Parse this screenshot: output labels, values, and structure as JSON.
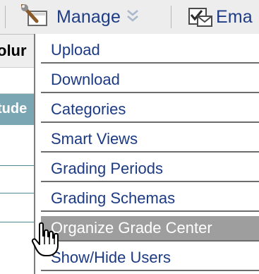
{
  "toolbar": {
    "manage_label": "Manage",
    "email_label": "Ema",
    "icons": [
      "wrench-icon",
      "chevron-down-icon",
      "email-icon"
    ]
  },
  "background": {
    "column_header_fragment": "olur",
    "student_header_fragment": "tude"
  },
  "menu": {
    "items": [
      {
        "label": "Upload"
      },
      {
        "label": "Download"
      },
      {
        "label": "Categories"
      },
      {
        "label": "Smart Views"
      },
      {
        "label": "Grading Periods"
      },
      {
        "label": "Grading Schemas"
      },
      {
        "label": "Organize Grade Center",
        "state": "hover"
      },
      {
        "label": "Show/Hide Users"
      }
    ]
  },
  "colors": {
    "link": "#1c3a84",
    "hover_bg": "#9e9e9e",
    "hover_text": "#ffffff",
    "toolbar_bg": "#ededed",
    "header_bg": "#7aa6b4"
  }
}
